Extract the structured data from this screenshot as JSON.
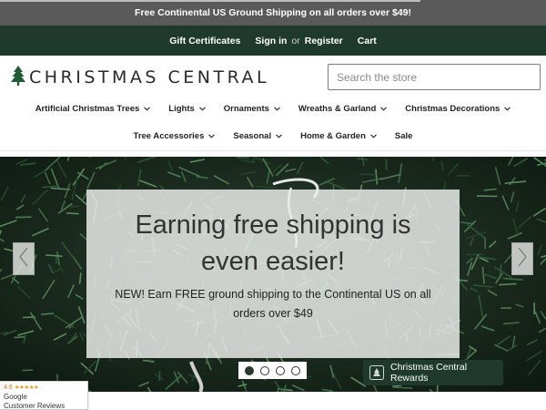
{
  "promo": {
    "text": "Free Continental US Ground Shipping on all orders over $49!",
    "progress": 0.77
  },
  "account": {
    "gift_certificates": "Gift Certificates",
    "sign_in": "Sign in",
    "or": "or",
    "register": "Register",
    "cart": "Cart"
  },
  "logo": {
    "text": "CHRISTMAS CENTRAL",
    "icon": "tree-icon"
  },
  "search": {
    "placeholder": "Search the store",
    "value": ""
  },
  "nav": {
    "row1": [
      {
        "label": "Artificial Christmas Trees",
        "dropdown": true
      },
      {
        "label": "Lights",
        "dropdown": true
      },
      {
        "label": "Ornaments",
        "dropdown": true
      },
      {
        "label": "Wreaths & Garland",
        "dropdown": true
      },
      {
        "label": "Christmas Decorations",
        "dropdown": true
      }
    ],
    "row2": [
      {
        "label": "Tree Accessories",
        "dropdown": true
      },
      {
        "label": "Seasonal",
        "dropdown": true
      },
      {
        "label": "Home & Garden",
        "dropdown": true
      },
      {
        "label": "Sale",
        "dropdown": false
      }
    ]
  },
  "hero": {
    "heading": "Earning free shipping is even easier!",
    "subtext": "NEW! Earn FREE ground shipping to the Continental US on all orders over $49",
    "slides_total": 4,
    "active_slide": 1,
    "prev_icon": "chevron-left-icon",
    "next_icon": "chevron-right-icon"
  },
  "rewards": {
    "label": "Christmas Central Rewards",
    "icon": "rewards-logo-icon"
  },
  "google_reviews": {
    "score": "4.6",
    "brand": "Google",
    "label": "Customer Reviews",
    "stars": 5
  },
  "colors": {
    "dark_green": "#1f3a2c",
    "promo_gray": "#5a5a5a",
    "star_orange": "#f29a1f"
  }
}
